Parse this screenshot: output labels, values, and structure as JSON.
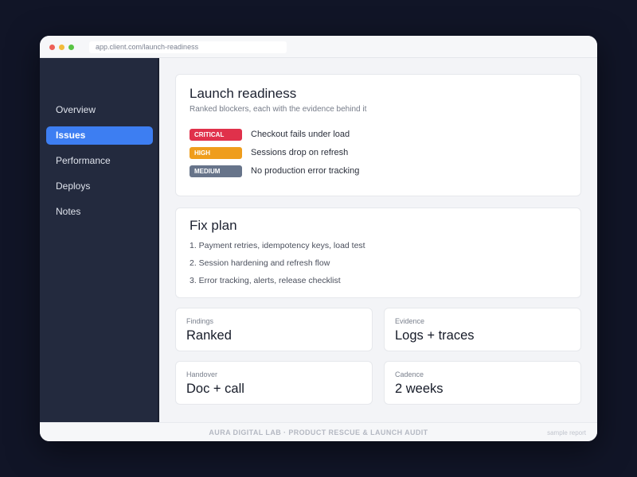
{
  "browser": {
    "url": "app.client.com/launch-readiness"
  },
  "sidebar": {
    "items": [
      {
        "label": "Overview",
        "active": false
      },
      {
        "label": "Issues",
        "active": true
      },
      {
        "label": "Performance",
        "active": false
      },
      {
        "label": "Deploys",
        "active": false
      },
      {
        "label": "Notes",
        "active": false
      }
    ]
  },
  "readiness": {
    "title": "Launch readiness",
    "subtitle": "Ranked blockers, each with the evidence behind it",
    "issues": [
      {
        "severity": "CRITICAL",
        "color": "#e0314b",
        "text": "Checkout fails under load"
      },
      {
        "severity": "HIGH",
        "color": "#ef9d1c",
        "text": "Sessions drop on refresh"
      },
      {
        "severity": "MEDIUM",
        "color": "#67748a",
        "text": "No production error tracking"
      }
    ]
  },
  "fix_plan": {
    "title": "Fix plan",
    "items": [
      "1.  Payment retries, idempotency keys, load test",
      "2.  Session hardening and refresh flow",
      "3.  Error tracking, alerts, release checklist"
    ]
  },
  "stats": [
    {
      "label": "Findings",
      "value": "Ranked"
    },
    {
      "label": "Evidence",
      "value": "Logs + traces"
    },
    {
      "label": "Handover",
      "value": "Doc + call"
    },
    {
      "label": "Cadence",
      "value": "2 weeks"
    }
  ],
  "footer": {
    "text": "AURA DIGITAL LAB  ·  PRODUCT RESCUE & LAUNCH AUDIT",
    "tag": "sample report"
  },
  "colors": {
    "accent": "#3d7ef2",
    "sidebar_bg": "#232a3e",
    "page_bg": "#111527"
  }
}
